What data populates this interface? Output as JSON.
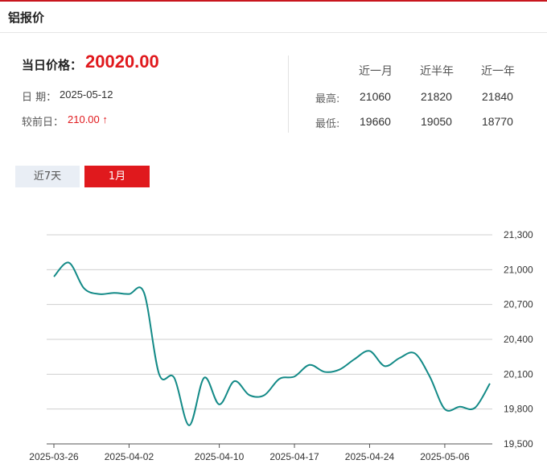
{
  "header": {
    "title": "铝报价"
  },
  "today": {
    "label": "当日价格：",
    "price": "20020.00",
    "date_label": "日  期：",
    "date_value": "2025-05-12",
    "change_label": "较前日：",
    "change_value": "210.00 ↑"
  },
  "stats": {
    "columns": [
      "近一月",
      "近半年",
      "近一年"
    ],
    "rows": [
      {
        "label": "最高:",
        "values": [
          "21060",
          "21820",
          "21840"
        ]
      },
      {
        "label": "最低:",
        "values": [
          "19660",
          "19050",
          "18770"
        ]
      }
    ]
  },
  "tabs": [
    {
      "label": "近7天",
      "active": false
    },
    {
      "label": "1月",
      "active": true
    }
  ],
  "colors": {
    "accent": "#e0191d",
    "line": "#138a87",
    "inactive_tab": "#e9eef5"
  },
  "chart_data": {
    "type": "line",
    "y_axis": {
      "min": 19500,
      "max": 21300,
      "ticks": [
        19500,
        19800,
        20100,
        20400,
        20700,
        21000,
        21300
      ],
      "tick_labels": [
        "19,500",
        "19,800",
        "20,100",
        "20,400",
        "20,700",
        "21,000",
        "21,300"
      ],
      "position": "right"
    },
    "x_tick_labels": [
      "2025-03-26",
      "2025-04-02",
      "2025-04-10",
      "2025-04-17",
      "2025-04-24",
      "2025-05-06"
    ],
    "x_tick_index": [
      0,
      5,
      11,
      16,
      21,
      26
    ],
    "grid": true,
    "series": [
      {
        "values": [
          20940,
          21060,
          20840,
          20790,
          20800,
          20790,
          20800,
          20100,
          20070,
          19660,
          20070,
          19840,
          20040,
          19920,
          19920,
          20060,
          20080,
          20180,
          20120,
          20140,
          20230,
          20300,
          20170,
          20240,
          20280,
          20080,
          19800,
          19820,
          19810,
          20020
        ]
      }
    ]
  }
}
